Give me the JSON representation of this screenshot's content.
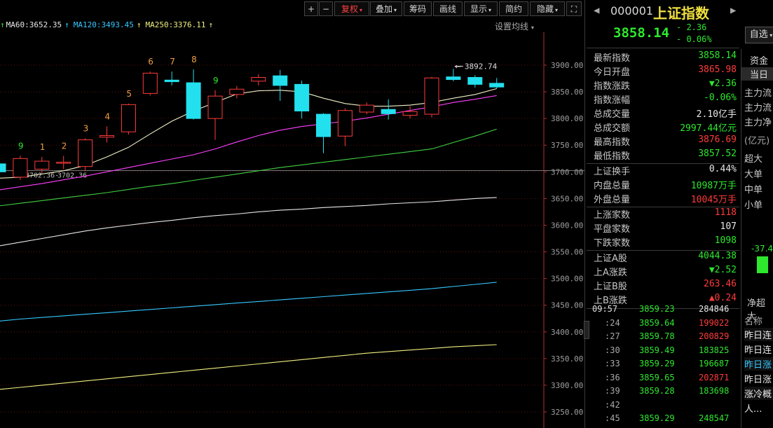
{
  "toolbar": {
    "buttons": [
      {
        "label": "+",
        "name": "zoom-in-button",
        "red": false
      },
      {
        "label": "−",
        "name": "zoom-out-button",
        "red": false
      },
      {
        "label": "复权",
        "name": "adjust-button",
        "red": true,
        "caret": true
      },
      {
        "label": "叠加",
        "name": "overlay-button",
        "red": false,
        "caret": true
      },
      {
        "label": "筹码",
        "name": "chips-button",
        "red": false
      },
      {
        "label": "画线",
        "name": "draw-line-button",
        "red": false
      },
      {
        "label": "显示",
        "name": "display-button",
        "red": false,
        "caret": true
      },
      {
        "label": "简约",
        "name": "simple-button",
        "red": false
      },
      {
        "label": "隐藏",
        "name": "hide-button",
        "red": false,
        "caret": true
      },
      {
        "label": "⛶",
        "name": "fullscreen-button",
        "red": false
      }
    ]
  },
  "ma_legend": [
    {
      "text": "MA60:3652.35",
      "color": "#e8e8e8"
    },
    {
      "text": "MA120:3493.45",
      "color": "#36c8ff"
    },
    {
      "text": "MA250:3376.11",
      "color": "#f0f080"
    }
  ],
  "settings_label": "设置均线",
  "chart_data": {
    "type": "candlestick",
    "y_ticks": [
      3900,
      3850,
      3800,
      3750,
      3700,
      3650,
      3600,
      3550,
      3500,
      3450,
      3400,
      3350,
      3300,
      3250
    ],
    "y_tick_labels": [
      "3900.00",
      "3850.00",
      "3800.00",
      "3750.00",
      "3700.00",
      "3650.00",
      "3600.00",
      "3550.00",
      "3500.00",
      "3450.00",
      "3400.00",
      "3350.00",
      "3300.00",
      "3250.00"
    ],
    "ylim": [
      3225,
      3945
    ],
    "reference_line": 3702.36,
    "reference_label": "3702.36",
    "reference_label_left": "3702.36",
    "high_annotation": "3892.74",
    "high_value": 3892.74,
    "candles": [
      {
        "o": 3700,
        "c": 3715,
        "h": 3720,
        "l": 3695,
        "up": false
      },
      {
        "o": 3690,
        "c": 3725,
        "h": 3730,
        "l": 3685,
        "up": true,
        "label": "9"
      },
      {
        "o": 3705,
        "c": 3720,
        "h": 3728,
        "l": 3698,
        "up": true,
        "label": "1"
      },
      {
        "o": 3718,
        "c": 3717,
        "h": 3730,
        "l": 3705,
        "up": true,
        "label": "2"
      },
      {
        "o": 3710,
        "c": 3760,
        "h": 3763,
        "l": 3702,
        "up": true,
        "label": "3"
      },
      {
        "o": 3765,
        "c": 3768,
        "h": 3785,
        "l": 3755,
        "up": true,
        "label": "4"
      },
      {
        "o": 3775,
        "c": 3826,
        "h": 3828,
        "l": 3770,
        "up": true,
        "label": "5"
      },
      {
        "o": 3847,
        "c": 3885,
        "h": 3888,
        "l": 3843,
        "up": true,
        "label": "6"
      },
      {
        "o": 3869,
        "c": 3872,
        "h": 3888,
        "l": 3862,
        "up": false,
        "label": "7"
      },
      {
        "o": 3867,
        "c": 3800,
        "h": 3892,
        "l": 3798,
        "up": false,
        "label": "8"
      },
      {
        "o": 3800,
        "c": 3842,
        "h": 3853,
        "l": 3760,
        "up": true,
        "label": "9"
      },
      {
        "o": 3845,
        "c": 3855,
        "h": 3861,
        "l": 3838,
        "up": true
      },
      {
        "o": 3870,
        "c": 3877,
        "h": 3883,
        "l": 3862,
        "up": true
      },
      {
        "o": 3880,
        "c": 3862,
        "h": 3891,
        "l": 3833,
        "up": false
      },
      {
        "o": 3864,
        "c": 3814,
        "h": 3871,
        "l": 3800,
        "up": false
      },
      {
        "o": 3808,
        "c": 3766,
        "h": 3810,
        "l": 3735,
        "up": false
      },
      {
        "o": 3767,
        "c": 3815,
        "h": 3819,
        "l": 3748,
        "up": true
      },
      {
        "o": 3812,
        "c": 3825,
        "h": 3830,
        "l": 3808,
        "up": true
      },
      {
        "o": 3817,
        "c": 3809,
        "h": 3836,
        "l": 3798,
        "up": false
      },
      {
        "o": 3806,
        "c": 3813,
        "h": 3823,
        "l": 3800,
        "up": true
      },
      {
        "o": 3808,
        "c": 3876,
        "h": 3878,
        "l": 3802,
        "up": true
      },
      {
        "o": 3878,
        "c": 3873,
        "h": 3893,
        "l": 3870,
        "up": false
      },
      {
        "o": 3877,
        "c": 3864,
        "h": 3881,
        "l": 3858,
        "up": false
      },
      {
        "o": 3866,
        "c": 3859,
        "h": 3876,
        "l": 3856,
        "up": false
      }
    ],
    "ma_lines": [
      {
        "name": "MA5",
        "color": "#f0f0c8",
        "values": [
          3688,
          3690,
          3696,
          3702,
          3712,
          3728,
          3746,
          3771,
          3795,
          3814,
          3830,
          3846,
          3852,
          3853,
          3850,
          3838,
          3828,
          3823,
          3823,
          3825,
          3830,
          3838,
          3845,
          3856
        ]
      },
      {
        "name": "MA10",
        "color": "#ff40ff",
        "values": [
          3666,
          3672,
          3678,
          3685,
          3692,
          3700,
          3708,
          3716,
          3724,
          3732,
          3743,
          3756,
          3768,
          3778,
          3785,
          3790,
          3795,
          3801,
          3808,
          3815,
          3822,
          3830,
          3836,
          3843
        ]
      },
      {
        "name": "MA20",
        "color": "#40d040",
        "values": [
          3636,
          3641,
          3646,
          3651,
          3656,
          3661,
          3667,
          3673,
          3678,
          3684,
          3690,
          3696,
          3702,
          3708,
          3713,
          3718,
          3723,
          3728,
          3733,
          3738,
          3743,
          3755,
          3767,
          3780
        ]
      },
      {
        "name": "MA60",
        "color": "#e8e8e8",
        "values": [
          3561,
          3568,
          3575,
          3582,
          3589,
          3595,
          3600,
          3605,
          3609,
          3614,
          3618,
          3621,
          3625,
          3628,
          3630,
          3633,
          3635,
          3637,
          3640,
          3642,
          3644,
          3647,
          3650,
          3652
        ]
      },
      {
        "name": "MA120",
        "color": "#36c8ff",
        "values": [
          3420,
          3424,
          3427,
          3430,
          3433,
          3436,
          3439,
          3442,
          3445,
          3448,
          3451,
          3454,
          3457,
          3460,
          3463,
          3466,
          3469,
          3472,
          3475,
          3478,
          3481,
          3485,
          3489,
          3493
        ]
      },
      {
        "name": "MA250",
        "color": "#f0f080",
        "values": [
          3292,
          3296,
          3300,
          3304,
          3308,
          3312,
          3316,
          3320,
          3324,
          3328,
          3332,
          3336,
          3340,
          3344,
          3348,
          3352,
          3356,
          3360,
          3363,
          3366,
          3369,
          3372,
          3374,
          3376
        ]
      }
    ]
  },
  "header": {
    "code": "000001",
    "name": "上证指数",
    "price": "3858.14",
    "change": "- 2.36",
    "change_pct": "- 0.06%",
    "watchlist_button": "自选"
  },
  "quote_rows": [
    {
      "label": "最新指数",
      "value": "3858.14",
      "color": "green"
    },
    {
      "label": "今日开盘",
      "value": "3865.98",
      "color": "red"
    },
    {
      "label": "指数涨跌",
      "value": "▼2.36",
      "color": "green"
    },
    {
      "label": "指数涨幅",
      "value": "-0.06%",
      "color": "green"
    },
    {
      "label": "总成交量",
      "value": "2.10",
      "unit": "亿手",
      "color": "white"
    },
    {
      "label": "总成交额",
      "value": "2997.44",
      "unit": "亿元",
      "color": "green"
    },
    {
      "label": "最高指数",
      "value": "3876.69",
      "color": "red"
    },
    {
      "label": "最低指数",
      "value": "3857.52",
      "color": "green"
    }
  ],
  "quote_rows2": [
    {
      "label": "上证换手",
      "value": "0.44%",
      "color": "white"
    },
    {
      "label": "内盘总量",
      "value": "10987",
      "unit": "万手",
      "color": "green"
    },
    {
      "label": "外盘总量",
      "value": "10045",
      "unit": "万手",
      "color": "red"
    }
  ],
  "quote_rows3": [
    {
      "label": "上涨家数",
      "value": "1118",
      "color": "red"
    },
    {
      "label": "平盘家数",
      "value": "107",
      "color": "white"
    },
    {
      "label": "下跌家数",
      "value": "1098",
      "color": "green"
    }
  ],
  "quote_rows4": [
    {
      "label": "上证A股",
      "value": "4044.38",
      "color": "green"
    },
    {
      "label": "上A涨跌",
      "value": "▼2.52",
      "color": "green"
    },
    {
      "label": "上证B股",
      "value": "263.46",
      "color": "red"
    },
    {
      "label": "上B涨跌",
      "value": "▲0.24",
      "color": "red"
    }
  ],
  "ticks": [
    {
      "time": "09:57",
      "price": "3859.23",
      "vol": "284846"
    },
    {
      "time": ":24",
      "price": "3859.64",
      "vol": "199022"
    },
    {
      "time": ":27",
      "price": "3859.78",
      "vol": "200829"
    },
    {
      "time": ":30",
      "price": "3859.49",
      "vol": "183825"
    },
    {
      "time": ":33",
      "price": "3859.29",
      "vol": "196687"
    },
    {
      "time": ":36",
      "price": "3859.65",
      "vol": "202871"
    },
    {
      "time": ":39",
      "price": "3859.28",
      "vol": "183698"
    },
    {
      "time": ":42",
      "price": "",
      "vol": ""
    },
    {
      "time": ":45",
      "price": "3859.29",
      "vol": "248547"
    }
  ],
  "side": {
    "tab_fund": "资金",
    "tab_today": "当日",
    "rows": [
      "主力流",
      "主力流",
      "主力净"
    ],
    "unit": "(亿元)",
    "size_rows": [
      "超大",
      "大单",
      "中单",
      "小单"
    ],
    "bar_value": "-37.4",
    "bar_label": "净超大",
    "name_header": "名称",
    "list": [
      "昨日连",
      "昨日连",
      "昨日涨",
      "昨日涨",
      "涨冷概",
      "人..."
    ]
  }
}
